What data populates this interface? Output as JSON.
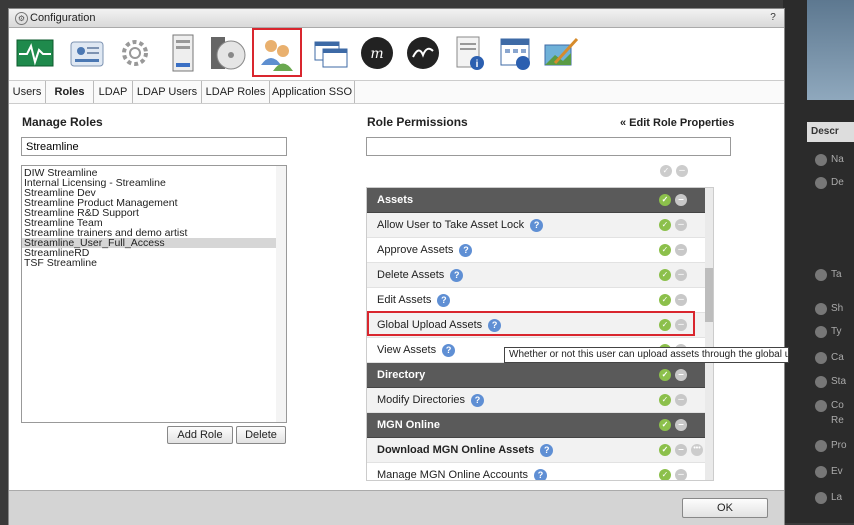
{
  "window": {
    "title": "Configuration",
    "help": "?"
  },
  "toolbar": {
    "icons": [
      "monitoring-icon",
      "user-card-icon",
      "gear-icon",
      "server-icon",
      "disc-icon",
      "roles-icon",
      "windows-icon",
      "mgn-logo-icon",
      "mgn-logo-icon",
      "document-info-icon",
      "calendar-icon",
      "image-edit-icon"
    ]
  },
  "tabs": [
    "Users",
    "Roles",
    "LDAP",
    "LDAP Users",
    "LDAP Roles",
    "Application SSO"
  ],
  "manage_roles": {
    "heading": "Manage Roles",
    "filter_value": "Streamline",
    "roles": [
      "DIW Streamline",
      "Internal Licensing - Streamline",
      "Streamline Dev",
      "Streamline Product Management",
      "Streamline R&D Support",
      "Streamline Team",
      "Streamline trainers and demo artist",
      "Streamline_User_Full_Access",
      "StreamlineRD",
      "TSF Streamline"
    ],
    "selected_role": "Streamline_User_Full_Access",
    "add_button": "Add Role",
    "delete_button": "Delete"
  },
  "role_permissions": {
    "heading": "Role Permissions",
    "edit_link": "« Edit Role Properties",
    "filter_value": "",
    "rows": [
      {
        "label": "Assets",
        "category": true
      },
      {
        "label": "Allow User to Take Asset Lock",
        "help": true,
        "checked": true
      },
      {
        "label": "Approve Assets",
        "help": true,
        "checked": true
      },
      {
        "label": "Delete Assets",
        "help": true,
        "checked": true
      },
      {
        "label": "Edit Assets",
        "help": true,
        "checked": true
      },
      {
        "label": "Global Upload Assets",
        "help": true,
        "checked": true,
        "highlighted": true
      },
      {
        "label": "View Assets",
        "help": true,
        "checked": true
      },
      {
        "label": "Directory",
        "category": true
      },
      {
        "label": "Modify Directories",
        "help": true,
        "checked": true
      },
      {
        "label": "MGN Online",
        "category": true
      },
      {
        "label": "Download MGN Online Assets",
        "help": true,
        "checked": true,
        "bold": true,
        "more": true
      },
      {
        "label": "Manage MGN Online Accounts",
        "help": true,
        "checked": true
      }
    ]
  },
  "tooltip": "Whether or not this user can upload assets through the global upload view.",
  "footer": {
    "ok_button": "OK"
  },
  "background_app": {
    "header": "Descr",
    "partial_labels": [
      "Na",
      "De",
      "Ta",
      "Sh",
      "Ty",
      "Ca",
      "Sta",
      "Co",
      "Re",
      "Pro",
      "Ev",
      "La"
    ]
  },
  "colors": {
    "highlight_red": "#d9262e",
    "category_bg": "#5a5a5a",
    "check_green": "#8cc04b",
    "help_blue": "#5f8fd4"
  }
}
